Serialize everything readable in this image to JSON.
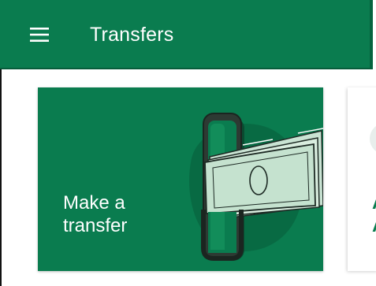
{
  "app_bar": {
    "title": "Transfers",
    "menu_icon": "hamburger-menu-icon",
    "background": "#0a7c4f"
  },
  "cards": [
    {
      "label": "Make a\ntransfer",
      "illustration": "phone-with-banknote-illustration",
      "background": "#0a7c4f"
    },
    {
      "label_partial": "A\nA",
      "icon": "circle-icon"
    }
  ],
  "colors": {
    "brand_green": "#0a7c4f",
    "white": "#ffffff"
  }
}
